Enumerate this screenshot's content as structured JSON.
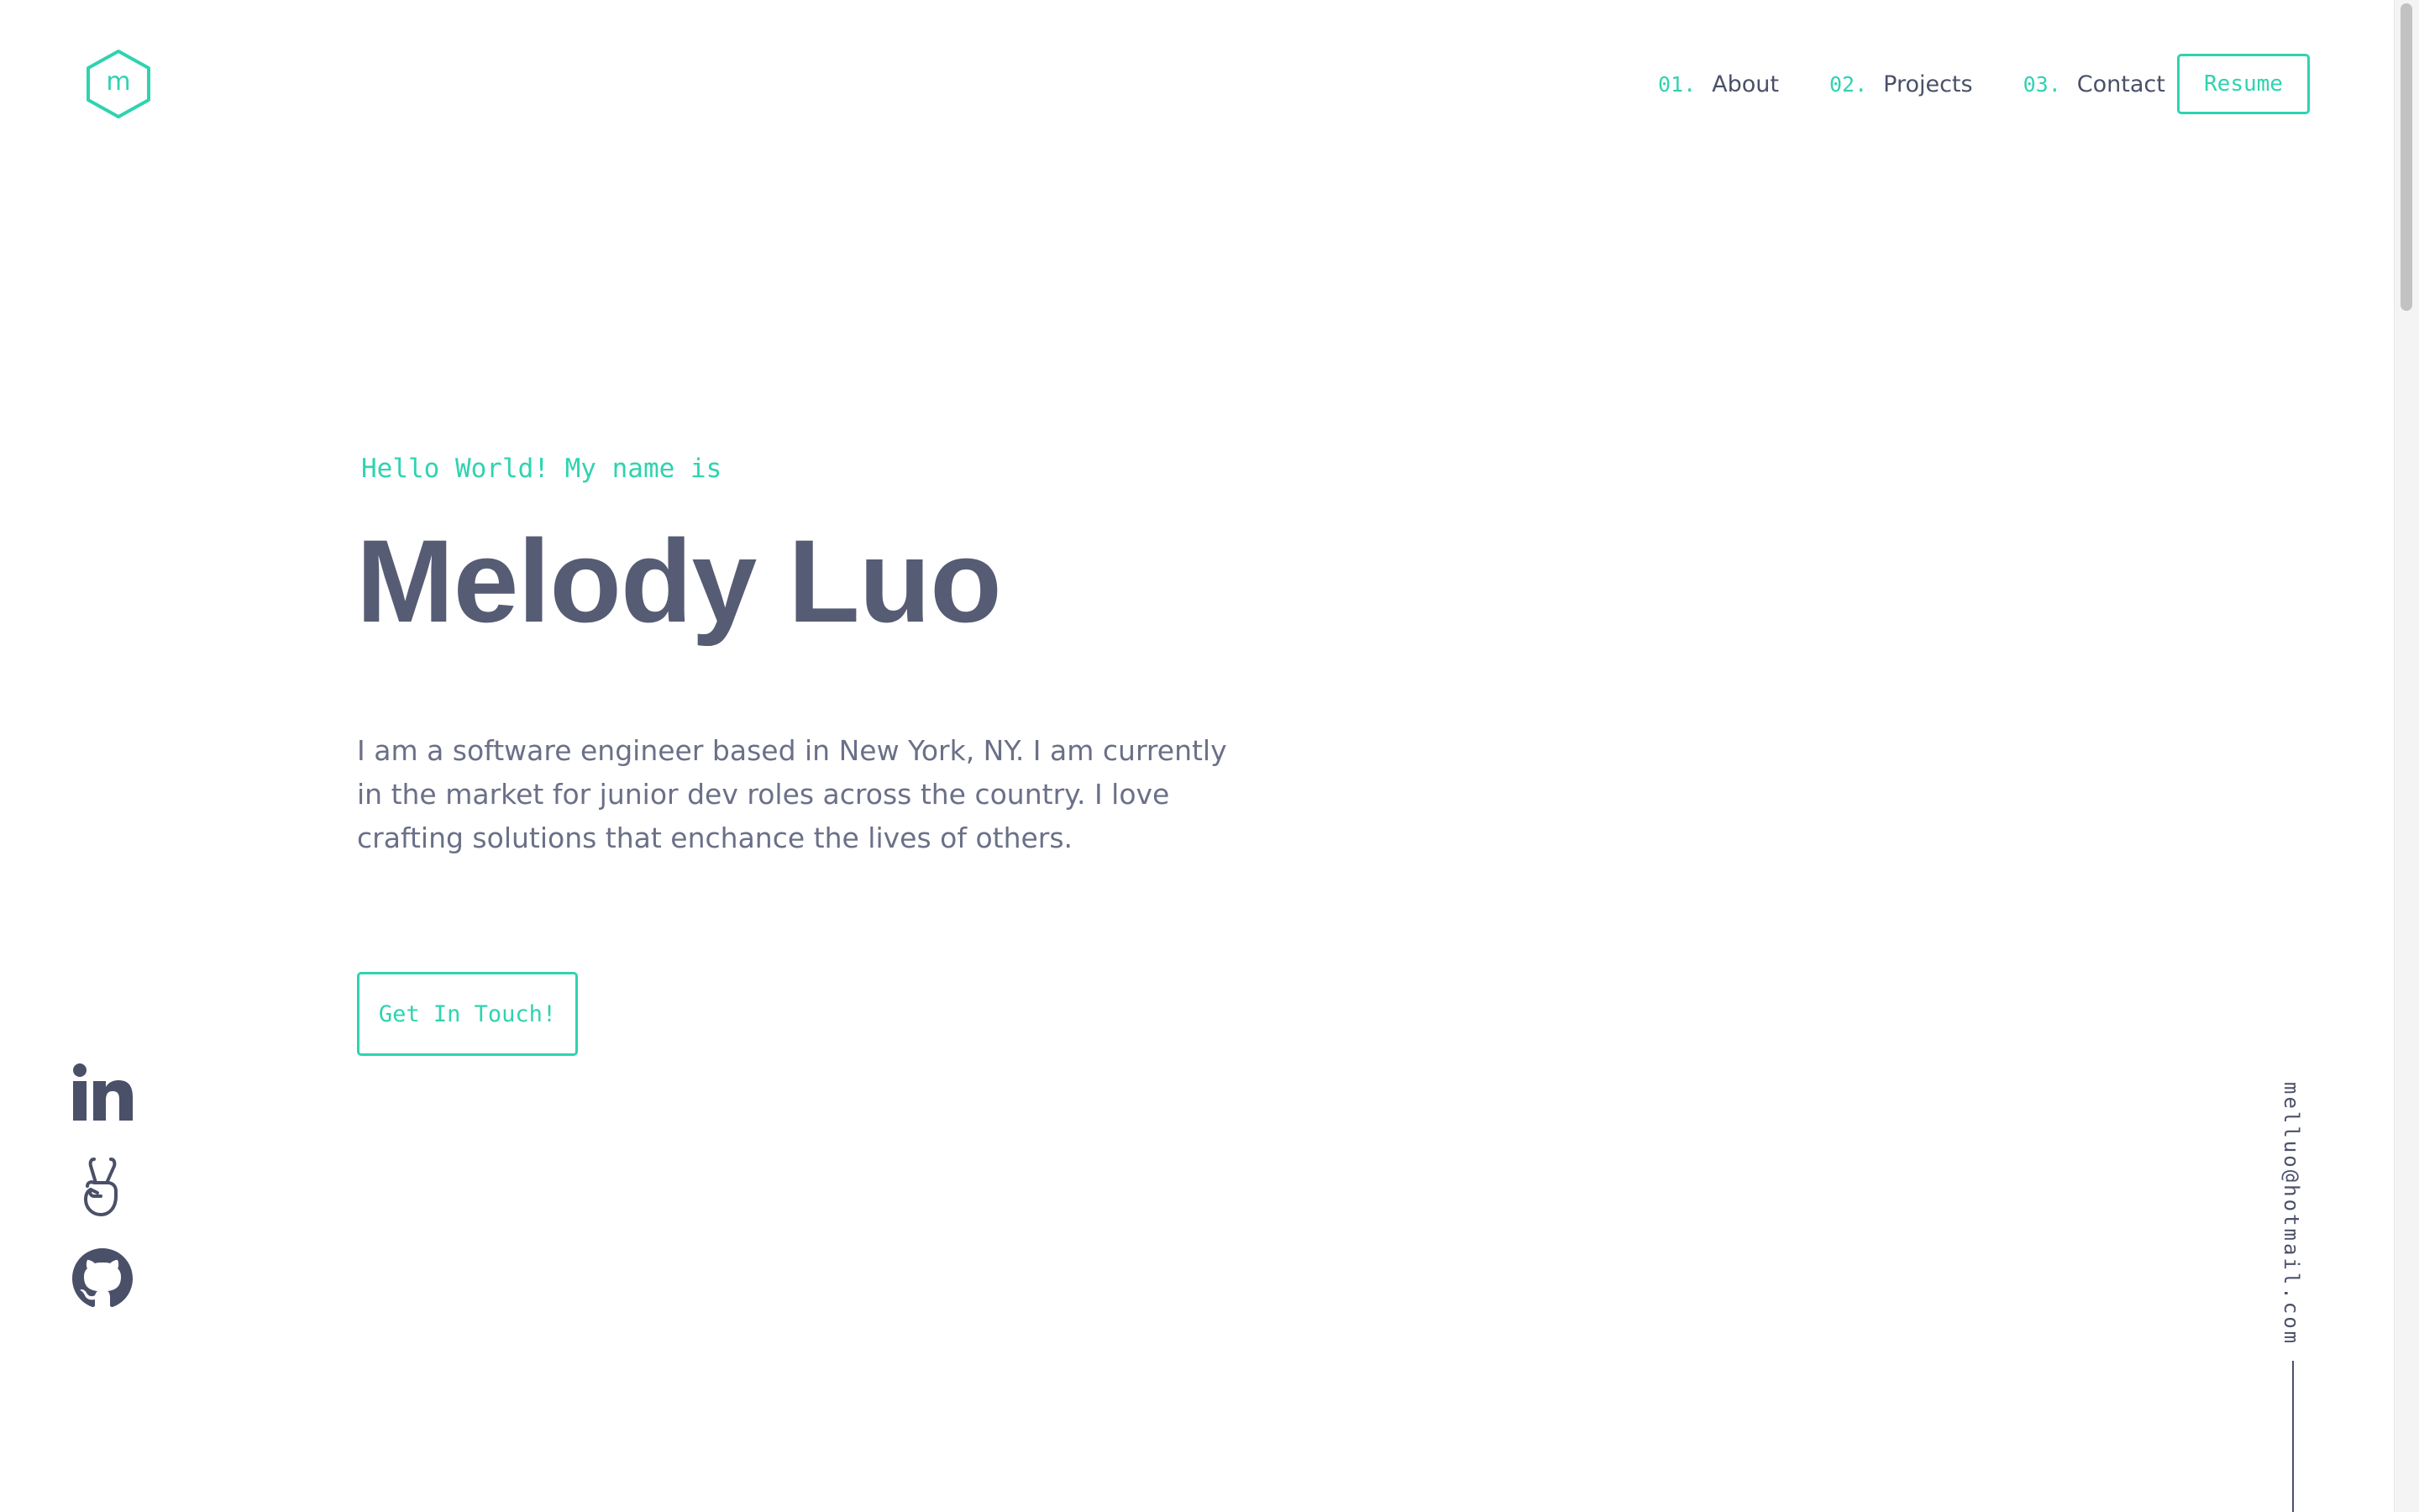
{
  "header": {
    "logo_letter": "m",
    "nav": [
      {
        "num": "01.",
        "label": "About"
      },
      {
        "num": "02.",
        "label": "Projects"
      },
      {
        "num": "03.",
        "label": "Contact"
      }
    ],
    "resume_label": "Resume"
  },
  "hero": {
    "greeting": "Hello World! My name is",
    "name": "Melody Luo",
    "bio": "I am a software engineer based in New York, NY. I am currently in the market for junior dev roles across the country. I love crafting solutions that enchance the lives of others.",
    "cta_label": "Get In Touch!"
  },
  "socials": [
    {
      "icon": "linkedin-icon"
    },
    {
      "icon": "angellist-icon"
    },
    {
      "icon": "github-icon"
    }
  ],
  "email": "melluo@hotmail.com",
  "colors": {
    "accent": "#2fd3b0",
    "heading": "#575c75",
    "text": "#6b7088",
    "nav_text": "#4a5068",
    "background": "#ffffff"
  }
}
